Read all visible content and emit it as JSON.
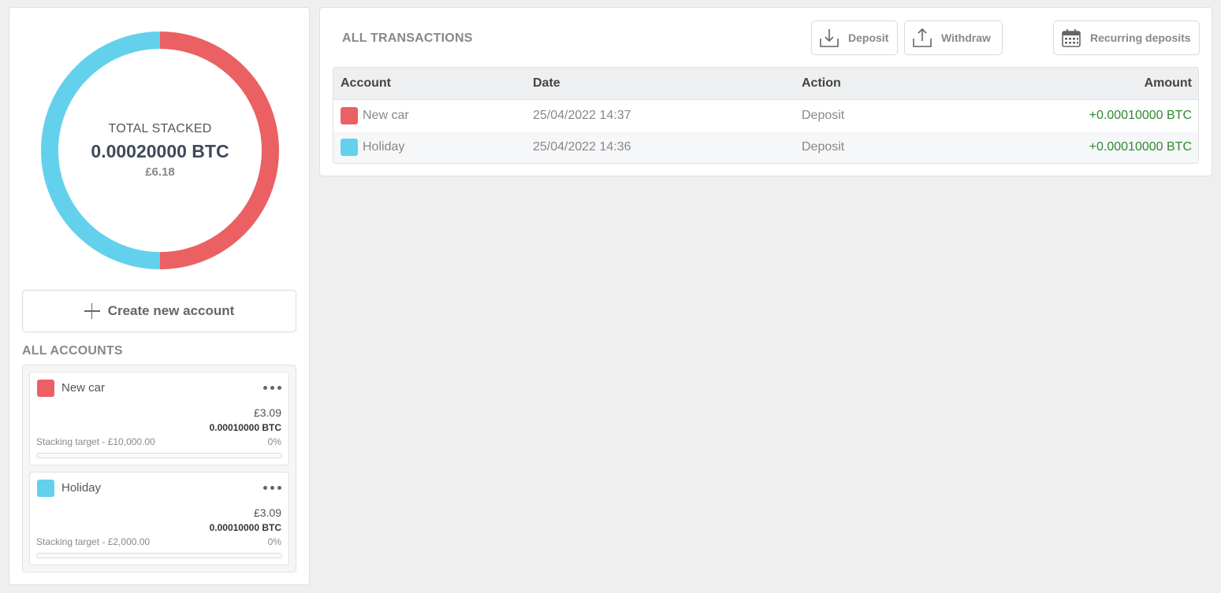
{
  "summary": {
    "total_label": "TOTAL STACKED",
    "total_btc": "0.00020000 BTC",
    "total_gbp": "£6.18",
    "donut": [
      {
        "account": "New car",
        "fraction": 0.5,
        "color": "#eb6063"
      },
      {
        "account": "Holiday",
        "fraction": 0.5,
        "color": "#63d1ec"
      }
    ]
  },
  "create_account": {
    "label": "Create new account"
  },
  "accounts": {
    "title": "ALL ACCOUNTS",
    "items": [
      {
        "name": "New car",
        "color": "#eb6063",
        "gbp": "£3.09",
        "btc": "0.00010000 BTC",
        "target": "Stacking target - £10,000.00",
        "percent": "0%",
        "progress": 0
      },
      {
        "name": "Holiday",
        "color": "#63d1ec",
        "gbp": "£3.09",
        "btc": "0.00010000 BTC",
        "target": "Stacking target - £2,000.00",
        "percent": "0%",
        "progress": 0
      }
    ]
  },
  "transactions": {
    "title": "ALL TRANSACTIONS",
    "buttons": {
      "deposit": "Deposit",
      "withdraw": "Withdraw",
      "recurring": "Recurring deposits"
    },
    "columns": [
      "Account",
      "Date",
      "Action",
      "Amount"
    ],
    "rows": [
      {
        "account": "New car",
        "color": "#eb6063",
        "date": "25/04/2022 14:37",
        "action": "Deposit",
        "amount": "+0.00010000 BTC"
      },
      {
        "account": "Holiday",
        "color": "#63d1ec",
        "date": "25/04/2022 14:36",
        "action": "Deposit",
        "amount": "+0.00010000 BTC"
      }
    ]
  }
}
